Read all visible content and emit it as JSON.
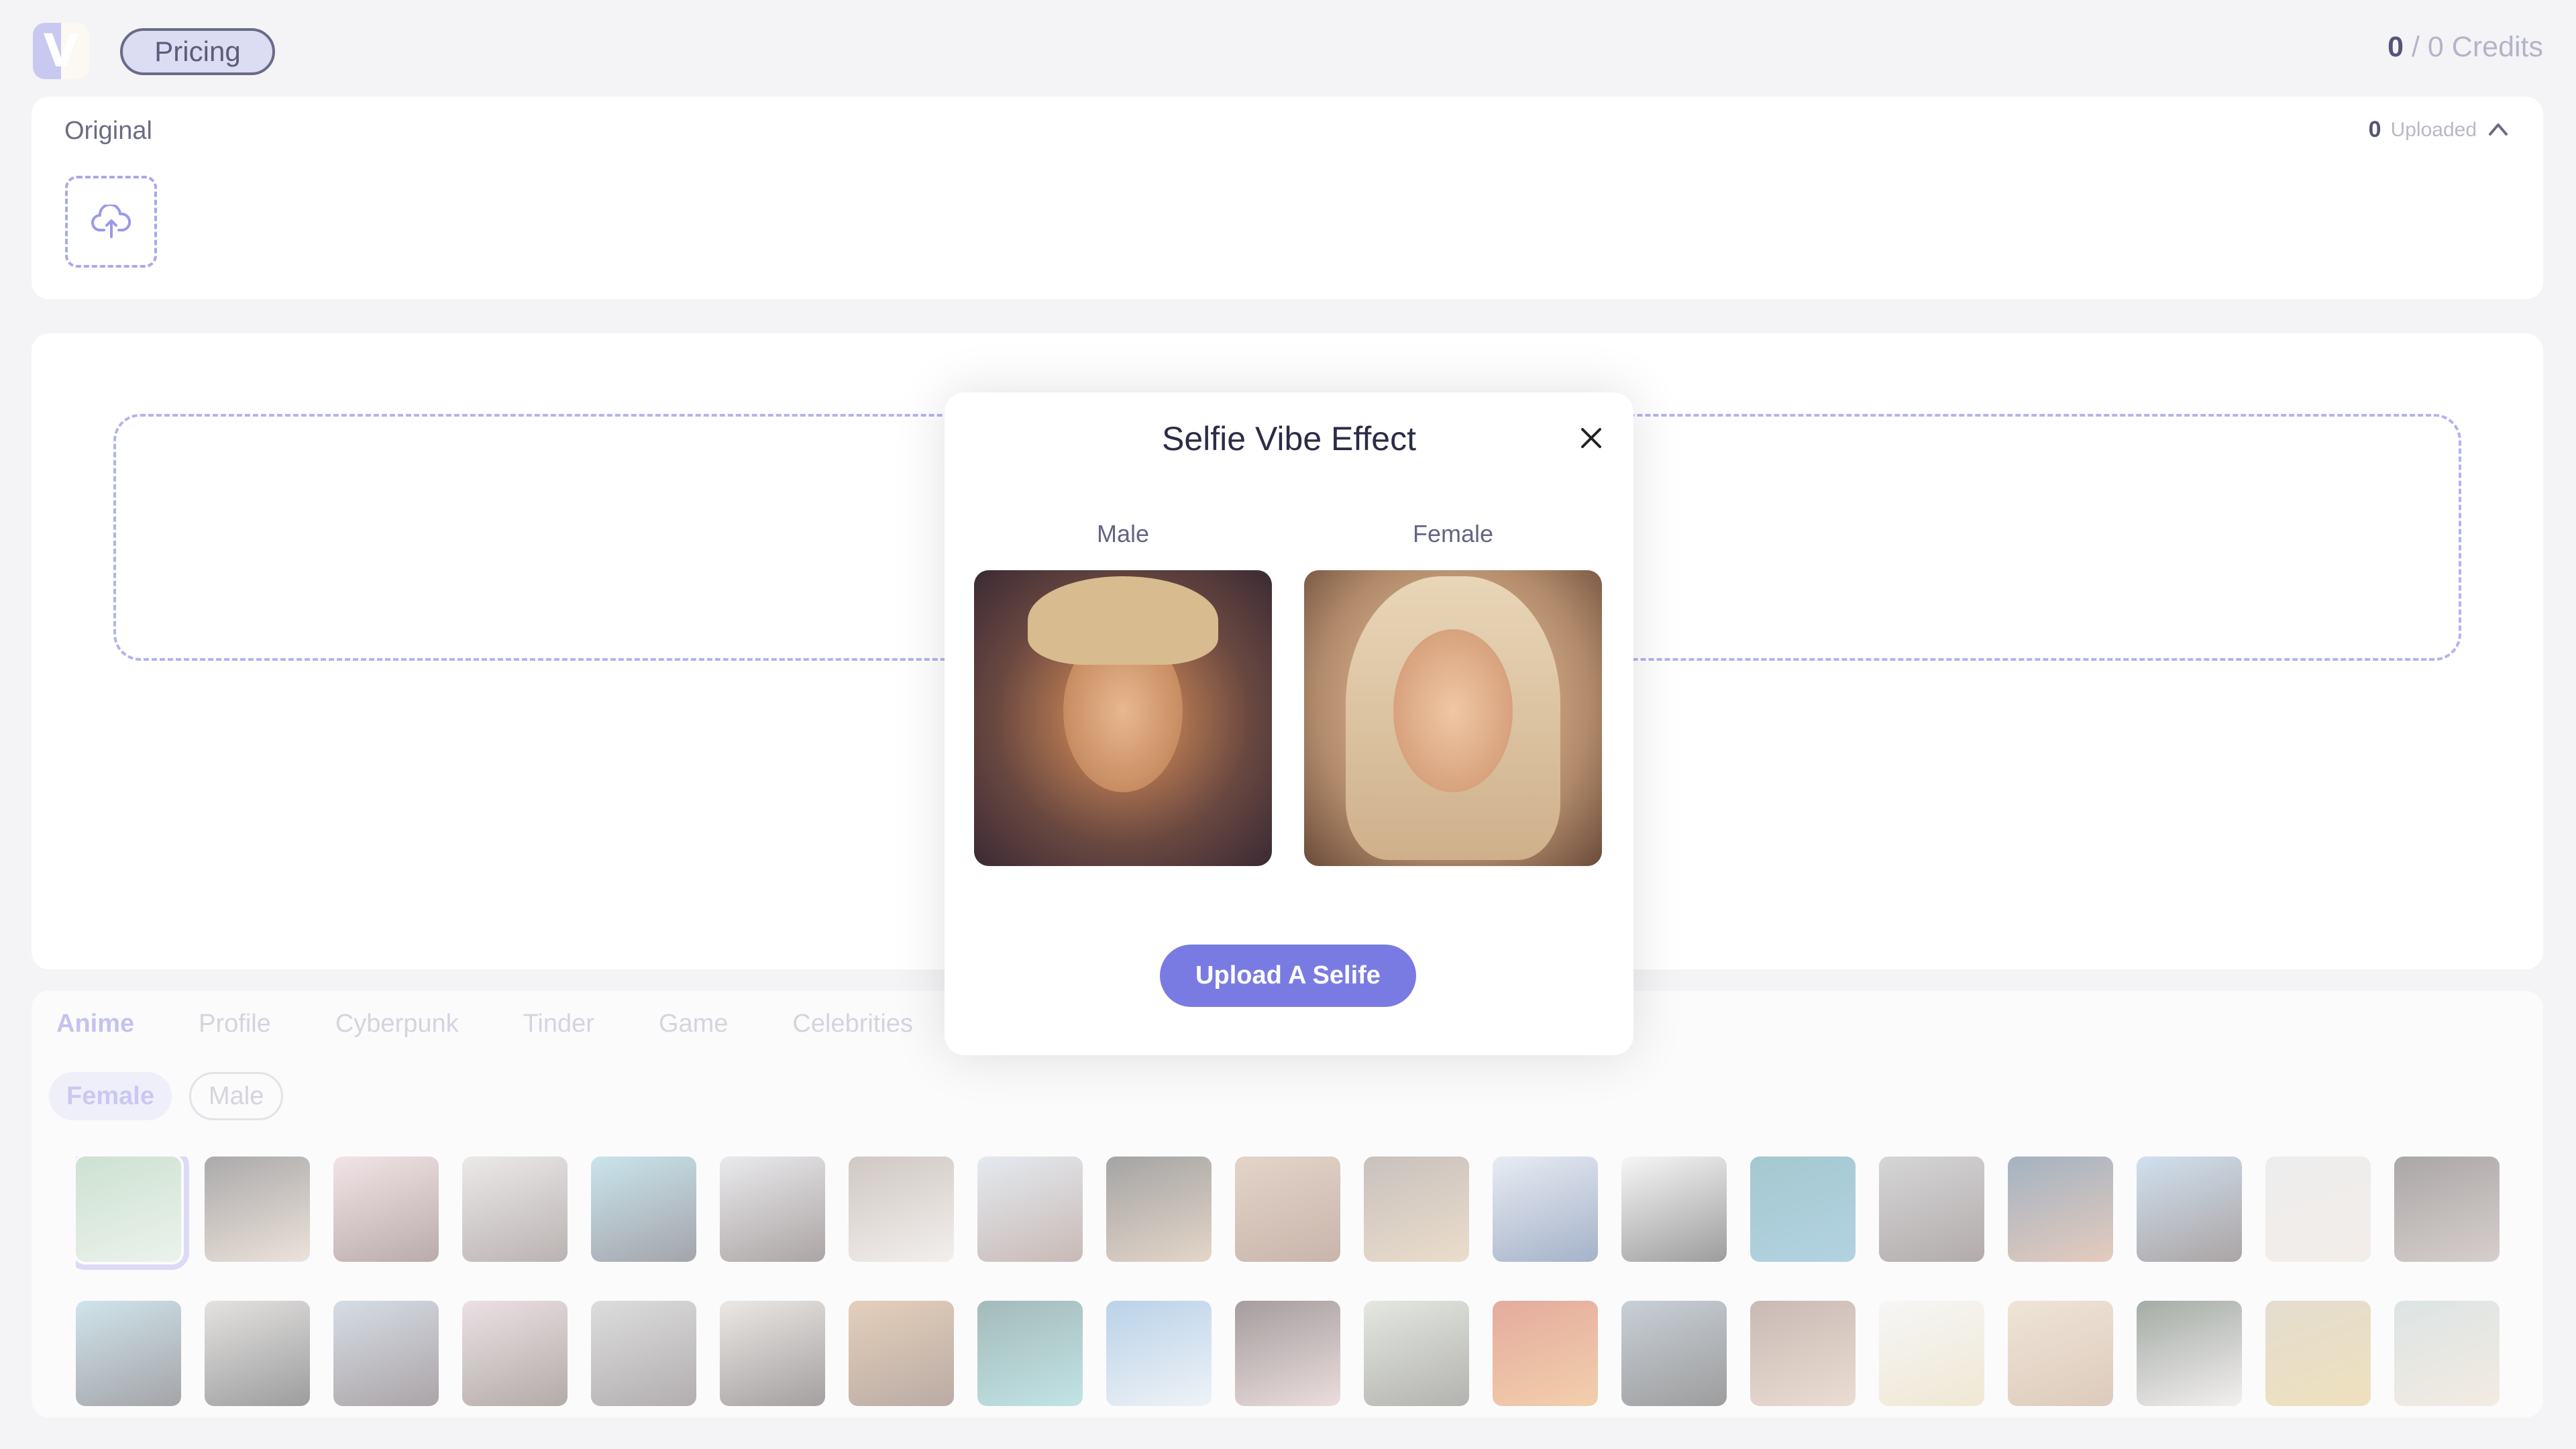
{
  "header": {
    "logo_letter": "V",
    "pricing_label": "Pricing",
    "credits": {
      "used": "0",
      "separator": " / ",
      "total": "0",
      "label": " Credits"
    }
  },
  "original_panel": {
    "title": "Original",
    "uploaded_count": "0",
    "uploaded_label": "Uploaded",
    "upload_icon": "cloud-upload-icon",
    "collapse_icon": "chevron-up-icon"
  },
  "styles_panel": {
    "tabs": [
      {
        "label": "Anime",
        "active": true
      },
      {
        "label": "Profile",
        "active": false
      },
      {
        "label": "Cyberpunk",
        "active": false
      },
      {
        "label": "Tinder",
        "active": false
      },
      {
        "label": "Game",
        "active": false
      },
      {
        "label": "Celebrities",
        "active": false
      }
    ],
    "gender_filters": [
      {
        "label": "Female",
        "active": true
      },
      {
        "label": "Male",
        "active": false
      }
    ],
    "thumbnail_colors": [
      [
        "#b9d8c0",
        "#e6efe6"
      ],
      [
        "#4a4648",
        "#d8c4b0"
      ],
      [
        "#e8c6cc",
        "#6a4a48"
      ],
      [
        "#d8d4d0",
        "#6a5a58"
      ],
      [
        "#8cc8d8",
        "#3a3a48"
      ],
      [
        "#d4d4d8",
        "#4a3a38"
      ],
      [
        "#9a8a80",
        "#e8e0d8"
      ],
      [
        "#c8d4e0",
        "#8a6a60"
      ],
      [
        "#3a3a3a",
        "#c8a888"
      ],
      [
        "#c8a48a",
        "#8a6048"
      ],
      [
        "#8a7a70",
        "#d8b890"
      ],
      [
        "#d0d8e8",
        "#3a5a8a"
      ],
      [
        "#f0f0f2",
        "#2a2a2a"
      ],
      [
        "#3a8a9a",
        "#5aa0c0"
      ],
      [
        "#a8a8aa",
        "#5a4a48"
      ],
      [
        "#3a5a7a",
        "#c89070"
      ],
      [
        "#9ac0e0",
        "#4a3a38"
      ],
      [
        "#dcdcdc",
        "#e8dcd0"
      ],
      [
        "#4a4040",
        "#a89890"
      ],
      [
        "#9ac8d8",
        "#3a3a40"
      ],
      [
        "#c8c4c0",
        "#2a2a2a"
      ],
      [
        "#a8b8c8",
        "#4a3a40"
      ],
      [
        "#d8c0c8",
        "#5a4a40"
      ],
      [
        "#b8b8b8",
        "#5a5050"
      ],
      [
        "#d8d0c8",
        "#3a3030"
      ],
      [
        "#c89a6a",
        "#6a4a3a"
      ],
      [
        "#3a6a6a",
        "#7ac8c8"
      ],
      [
        "#6aa0d0",
        "#e0e8f0"
      ],
      [
        "#3a2a2a",
        "#d8b8b8"
      ],
      [
        "#c8d0c0",
        "#5a5a50"
      ],
      [
        "#c84a2a",
        "#e89a4a"
      ],
      [
        "#8a9aa8",
        "#2a2a2a"
      ],
      [
        "#8a6a5a",
        "#d8b8a0"
      ],
      [
        "#f0f0f0",
        "#e0d0a0"
      ],
      [
        "#e0c8a8",
        "#b89070"
      ],
      [
        "#3a4a3a",
        "#e8e0e0"
      ],
      [
        "#c8b898",
        "#e0c070"
      ],
      [
        "#b8c8c8",
        "#e8d8c0"
      ]
    ]
  },
  "modal": {
    "title": "Selfie Vibe Effect",
    "close_icon": "close-icon",
    "options": [
      {
        "label": "Male"
      },
      {
        "label": "Female"
      }
    ],
    "cta_label": "Upload A Selife",
    "accent_color": "#7a7be2"
  }
}
